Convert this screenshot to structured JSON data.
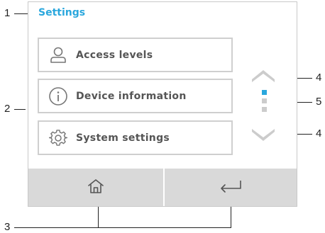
{
  "screen": {
    "title": "Settings",
    "menu": [
      {
        "label": "Access levels",
        "icon": "user-icon"
      },
      {
        "label": "Device information",
        "icon": "info-icon"
      },
      {
        "label": "System settings",
        "icon": "gear-icon"
      }
    ],
    "scroll": {
      "up_icon": "chevron-up-icon",
      "down_icon": "chevron-down-icon",
      "page": 1,
      "pages": 3
    },
    "bottom_bar": {
      "home_icon": "home-icon",
      "back_icon": "return-arrow-icon"
    }
  },
  "callouts": [
    "1",
    "2",
    "3",
    "4",
    "5",
    "4"
  ],
  "colors": {
    "accent": "#2aa7dd",
    "border": "#cfcfcf",
    "bar": "#d9d9d9",
    "inactive_dot": "#cccccc",
    "icon": "#777777"
  }
}
